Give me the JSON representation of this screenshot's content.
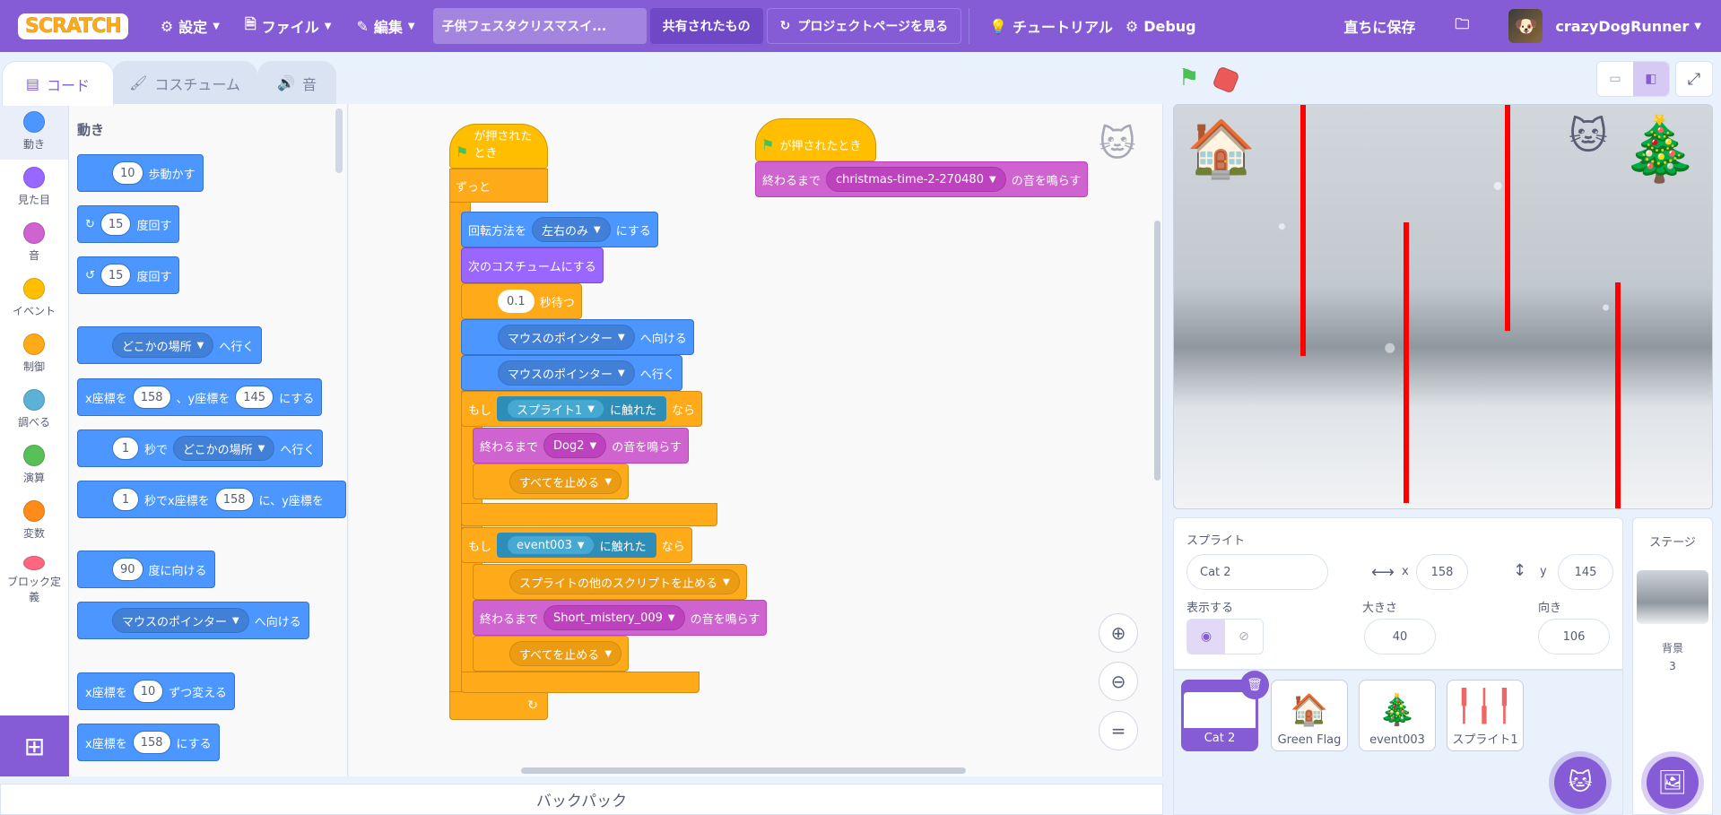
{
  "menu": {
    "logo": "SCRATCH",
    "settings": "設定",
    "file": "ファイル",
    "edit": "編集",
    "project_title": "子供フェスタクリスマスイ...",
    "shared": "共有されたもの",
    "see_project_page": "プロジェクトページを見る",
    "tutorial": "チュートリアル",
    "debug": "Debug",
    "save_now": "直ちに保存",
    "username": "crazyDogRunner"
  },
  "tabs": {
    "code": "コード",
    "costume": "コスチューム",
    "sound": "音"
  },
  "categories": [
    {
      "label": "動き",
      "color": "#4c97ff"
    },
    {
      "label": "見た目",
      "color": "#9966ff"
    },
    {
      "label": "音",
      "color": "#cf63cf"
    },
    {
      "label": "イベント",
      "color": "#ffbf00"
    },
    {
      "label": "制御",
      "color": "#ffab19"
    },
    {
      "label": "調べる",
      "color": "#5cb1d6"
    },
    {
      "label": "演算",
      "color": "#59c059"
    },
    {
      "label": "変数",
      "color": "#ff8c1a"
    },
    {
      "label": "ブロック定義",
      "color": "#ff6680"
    }
  ],
  "palette": {
    "heading": "動き",
    "move_steps": {
      "num": "10",
      "text": "歩動かす"
    },
    "turn_right": {
      "num": "15",
      "text": "度回す"
    },
    "turn_left": {
      "num": "15",
      "text": "度回す"
    },
    "goto": {
      "dd": "どこかの場所",
      "text": "へ行く"
    },
    "gotoxy": {
      "t1": "x座標を",
      "x": "158",
      "t2": "、y座標を",
      "y": "145",
      "t3": "にする"
    },
    "glide": {
      "num": "1",
      "t1": "秒で",
      "dd": "どこかの場所",
      "t2": "へ行く"
    },
    "glidexy": {
      "num": "1",
      "t1": "秒でx座標を",
      "x": "158",
      "t2": "に、y座標を"
    },
    "point_dir": {
      "num": "90",
      "text": "度に向ける"
    },
    "point_towards": {
      "dd": "マウスのポインター",
      "text": "へ向ける"
    },
    "change_x": {
      "t1": "x座標を",
      "num": "10",
      "t2": "ずつ変える"
    },
    "set_x": {
      "t1": "x座標を",
      "num": "158",
      "t2": "にする"
    }
  },
  "script1": {
    "hat": "が押されたとき",
    "forever": "ずっと",
    "rotation": {
      "t1": "回転方法を",
      "dd": "左右のみ",
      "t2": "にする"
    },
    "next_costume": "次のコスチュームにする",
    "wait": {
      "num": "0.1",
      "text": "秒待つ"
    },
    "point": {
      "dd": "マウスのポインター",
      "text": "へ向ける"
    },
    "goto": {
      "dd": "マウスのポインター",
      "text": "へ行く"
    },
    "if1": {
      "t1": "もし",
      "dd": "スプライト1",
      "t2": "に触れた",
      "t3": "なら"
    },
    "play1": {
      "t1": "終わるまで",
      "dd": "Dog2",
      "t2": "の音を鳴らす"
    },
    "stop1": "すべてを止める",
    "if2": {
      "t1": "もし",
      "dd": "event003",
      "t2": "に触れた",
      "t3": "なら"
    },
    "stop_other": "スプライトの他のスクリプトを止める",
    "play2": {
      "t1": "終わるまで",
      "dd": "Short_mistery_009",
      "t2": "の音を鳴らす"
    },
    "stop2": "すべてを止める"
  },
  "script2": {
    "hat": "が押されたとき",
    "play": {
      "t1": "終わるまで",
      "dd": "christmas-time-2-270480",
      "t2": "の音を鳴らす"
    }
  },
  "backpack": "バックパック",
  "sprite_info": {
    "label": "スプライト",
    "name": "Cat 2",
    "x_label": "x",
    "x": "158",
    "y_label": "y",
    "y": "145",
    "show_label": "表示する",
    "size_label": "大きさ",
    "size": "40",
    "direction_label": "向き",
    "direction": "106"
  },
  "sprites": [
    {
      "name": "Cat 2",
      "icon": "cat-icon"
    },
    {
      "name": "Green Flag",
      "icon": "house-icon"
    },
    {
      "name": "event003",
      "icon": "tree-icon"
    },
    {
      "name": "スプライト1",
      "icon": "redbars-icon"
    }
  ],
  "stage_panel": {
    "label": "ステージ",
    "backdrop_label": "背景",
    "backdrop_count": "3"
  }
}
